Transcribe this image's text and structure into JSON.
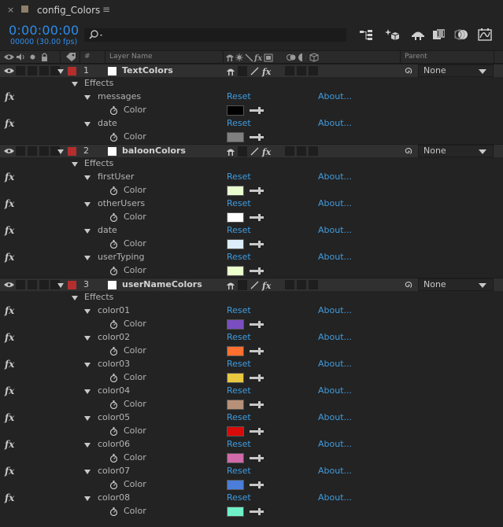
{
  "tab": {
    "close": "×",
    "title": "config_Colors",
    "menu": "≡"
  },
  "toolbar": {
    "timecode": "0:00:00:00",
    "fps": "00000 (30.00 fps)"
  },
  "header": {
    "col_num": "#",
    "col_layer_name": "Layer Name",
    "col_parent": "Parent"
  },
  "labels": {
    "effects": "Effects",
    "reset": "Reset",
    "about": "About...",
    "color": "Color",
    "parent_none": "None"
  },
  "layers": [
    {
      "num": "1",
      "name": "TextColors",
      "effects": [
        {
          "name": "messages",
          "color": "#000000"
        },
        {
          "name": "date",
          "color": "#808080"
        }
      ]
    },
    {
      "num": "2",
      "name": "baloonColors",
      "effects": [
        {
          "name": "firstUser",
          "color": "#e8fcd0"
        },
        {
          "name": "otherUsers",
          "color": "#ffffff"
        },
        {
          "name": "date",
          "color": "#dcecf8"
        },
        {
          "name": "userTyping",
          "color": "#eaffcc"
        }
      ]
    },
    {
      "num": "3",
      "name": "userNameColors",
      "effects": [
        {
          "name": "color01",
          "color": "#7a4ec0"
        },
        {
          "name": "color02",
          "color": "#ff7030"
        },
        {
          "name": "color03",
          "color": "#e8c840"
        },
        {
          "name": "color04",
          "color": "#b89078"
        },
        {
          "name": "color05",
          "color": "#d80a0a"
        },
        {
          "name": "color06",
          "color": "#d06aa8"
        },
        {
          "name": "color07",
          "color": "#4a7ed8"
        },
        {
          "name": "color08",
          "color": "#70f0c8"
        }
      ]
    }
  ],
  "colors": {
    "accent": "#2d8ceb",
    "link": "#3f9ce0",
    "label_red": "#b52e2e"
  }
}
